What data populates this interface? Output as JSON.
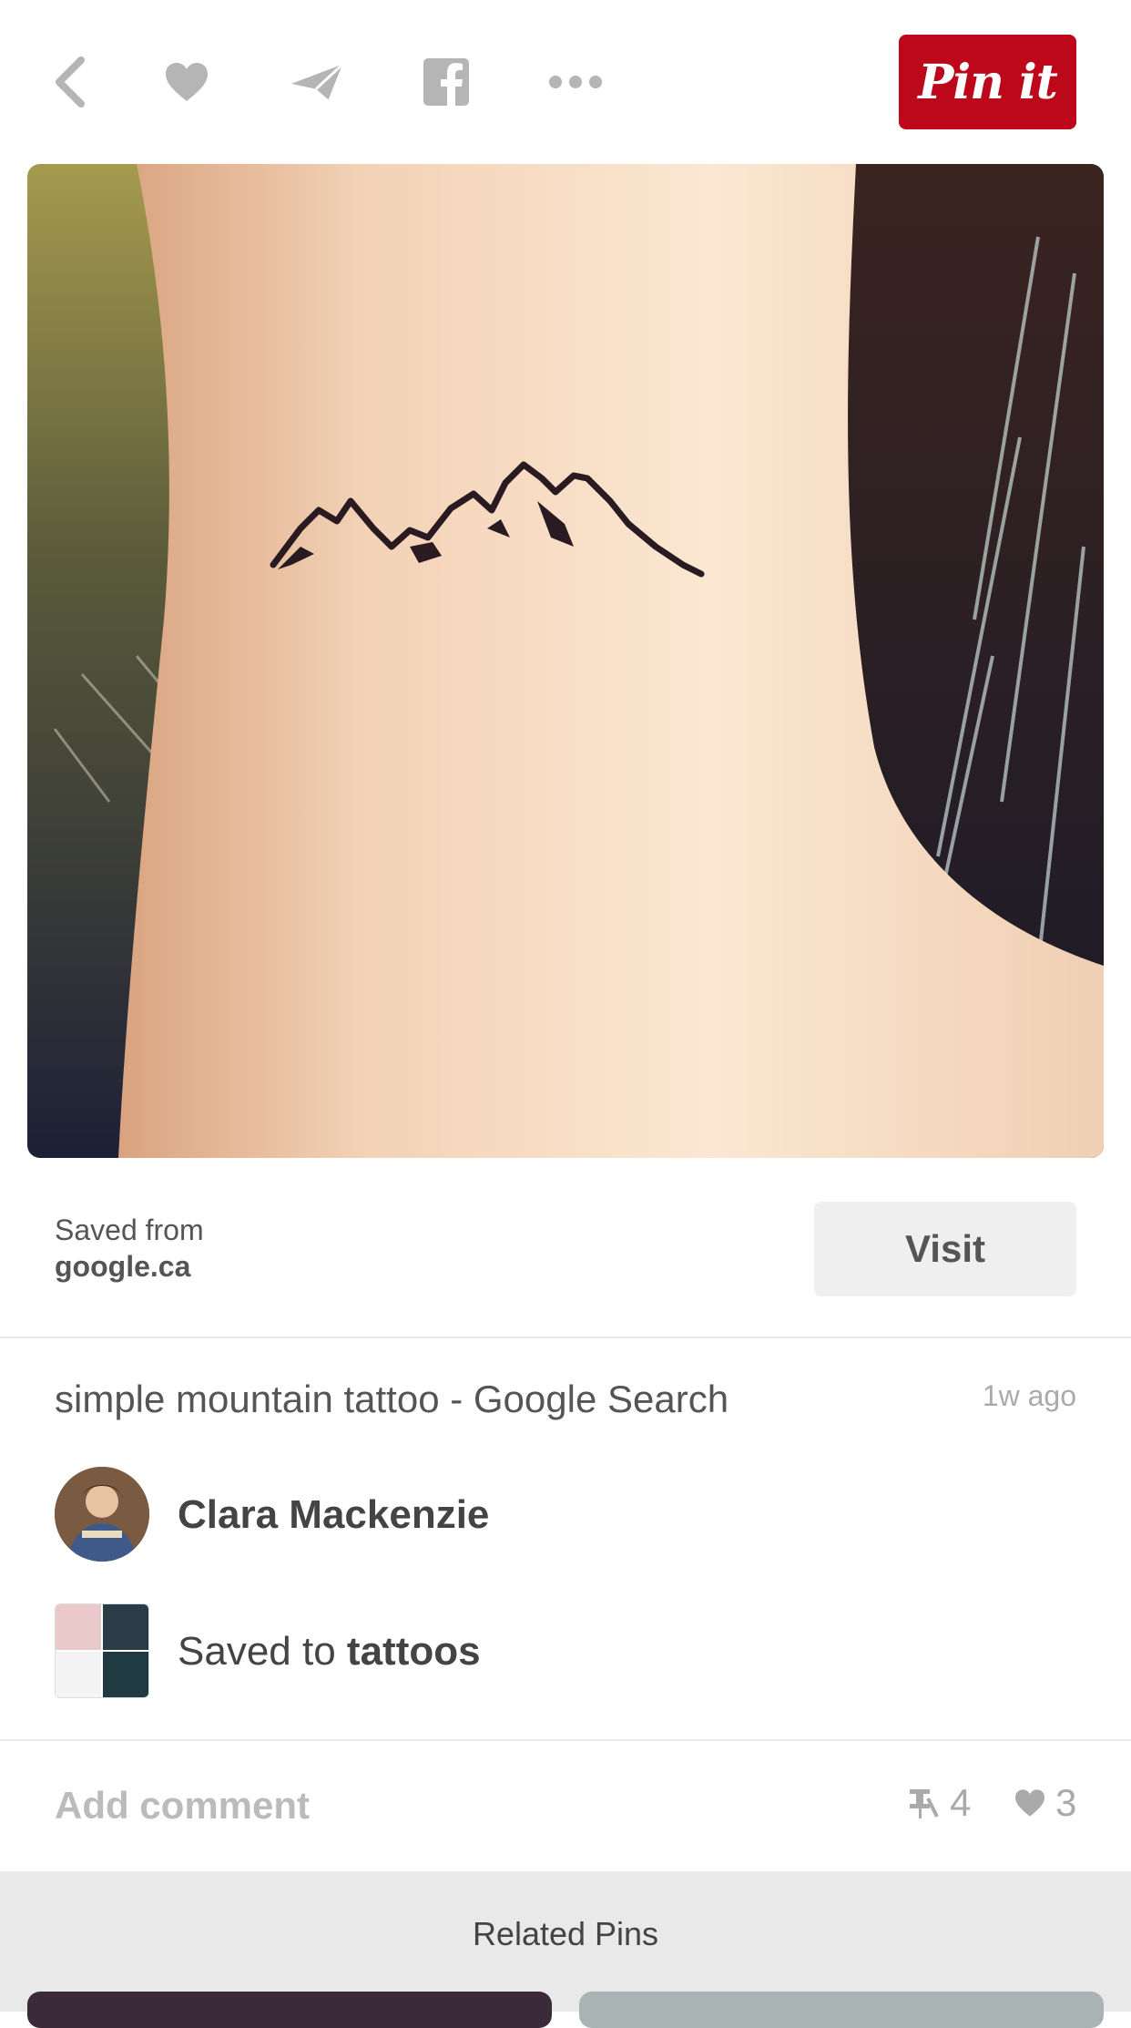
{
  "toolbar": {
    "icons": [
      "back-icon",
      "heart-icon",
      "send-icon",
      "facebook-icon",
      "more-icon"
    ],
    "pin_label": "Pin it",
    "accent": "#bd081c"
  },
  "pin": {
    "image_subject": "mountain tattoo",
    "saved_from_label": "Saved from",
    "source_site": "google.ca",
    "visit_label": "Visit",
    "title": "simple mountain tattoo - Google Search",
    "time_ago": "1w ago",
    "user_name": "Clara Mackenzie",
    "saved_to_prefix": "Saved to",
    "board_name": "tattoos"
  },
  "comments": {
    "placeholder": "Add comment",
    "repins": "4",
    "likes": "3"
  },
  "related": {
    "title": "Related Pins"
  }
}
